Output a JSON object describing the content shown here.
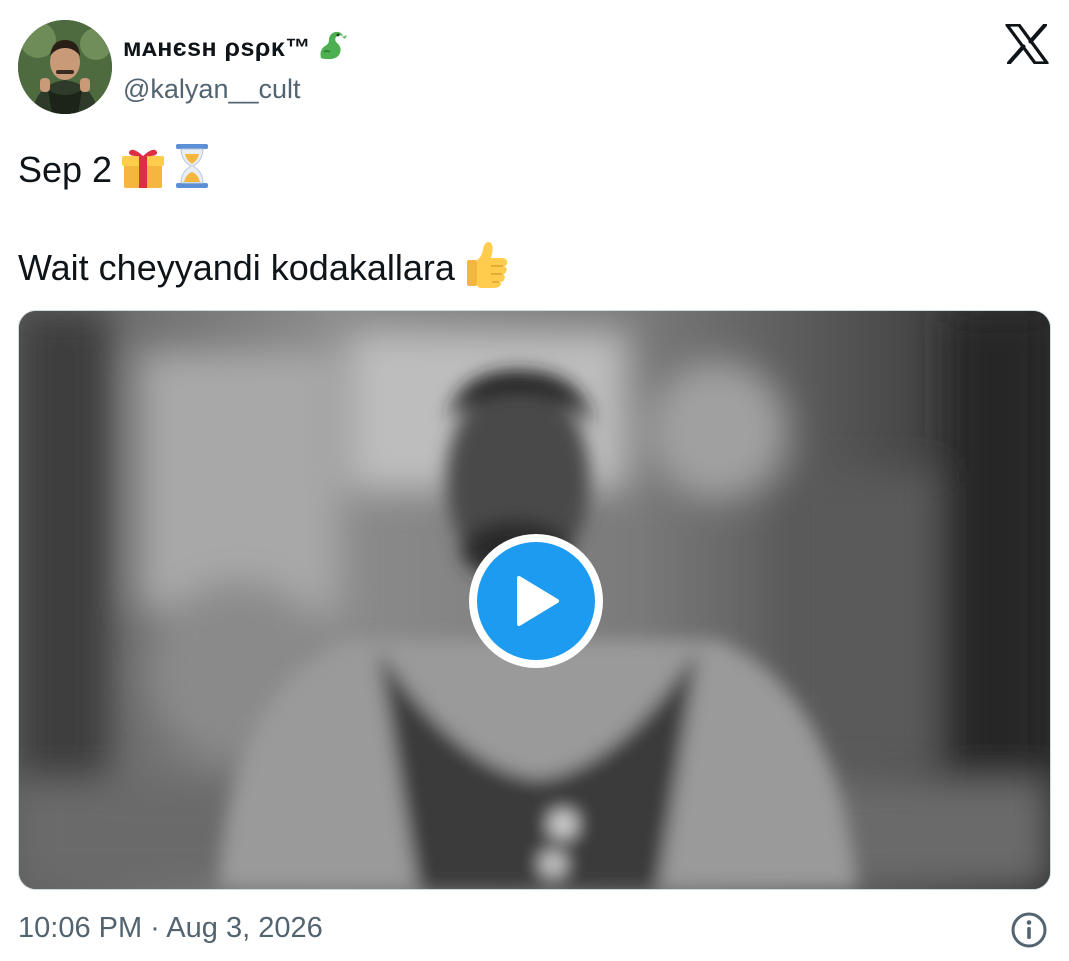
{
  "author": {
    "display_name": "ᴍᴀʜєѕʜ ρѕρκ™",
    "handle": "@kalyan__cult",
    "name_emoji": "dragon-emoji"
  },
  "platform_icon": "x-logo-icon",
  "tweet": {
    "line1_text": "Sep 2",
    "line1_emojis": [
      "gift-emoji",
      "hourglass-emoji"
    ],
    "line2_text": "Wait cheyyandi kodakallara",
    "line2_emojis": [
      "thumbs-up-emoji"
    ]
  },
  "media": {
    "type": "video",
    "play_icon": "play-icon",
    "accent_color": "#1d9bf0"
  },
  "footer": {
    "timestamp": "10:06 PM · Aug 3, 2026",
    "info_icon": "info-icon"
  },
  "colors": {
    "text": "#0f1419",
    "secondary": "#536471",
    "accent": "#1d9bf0"
  }
}
